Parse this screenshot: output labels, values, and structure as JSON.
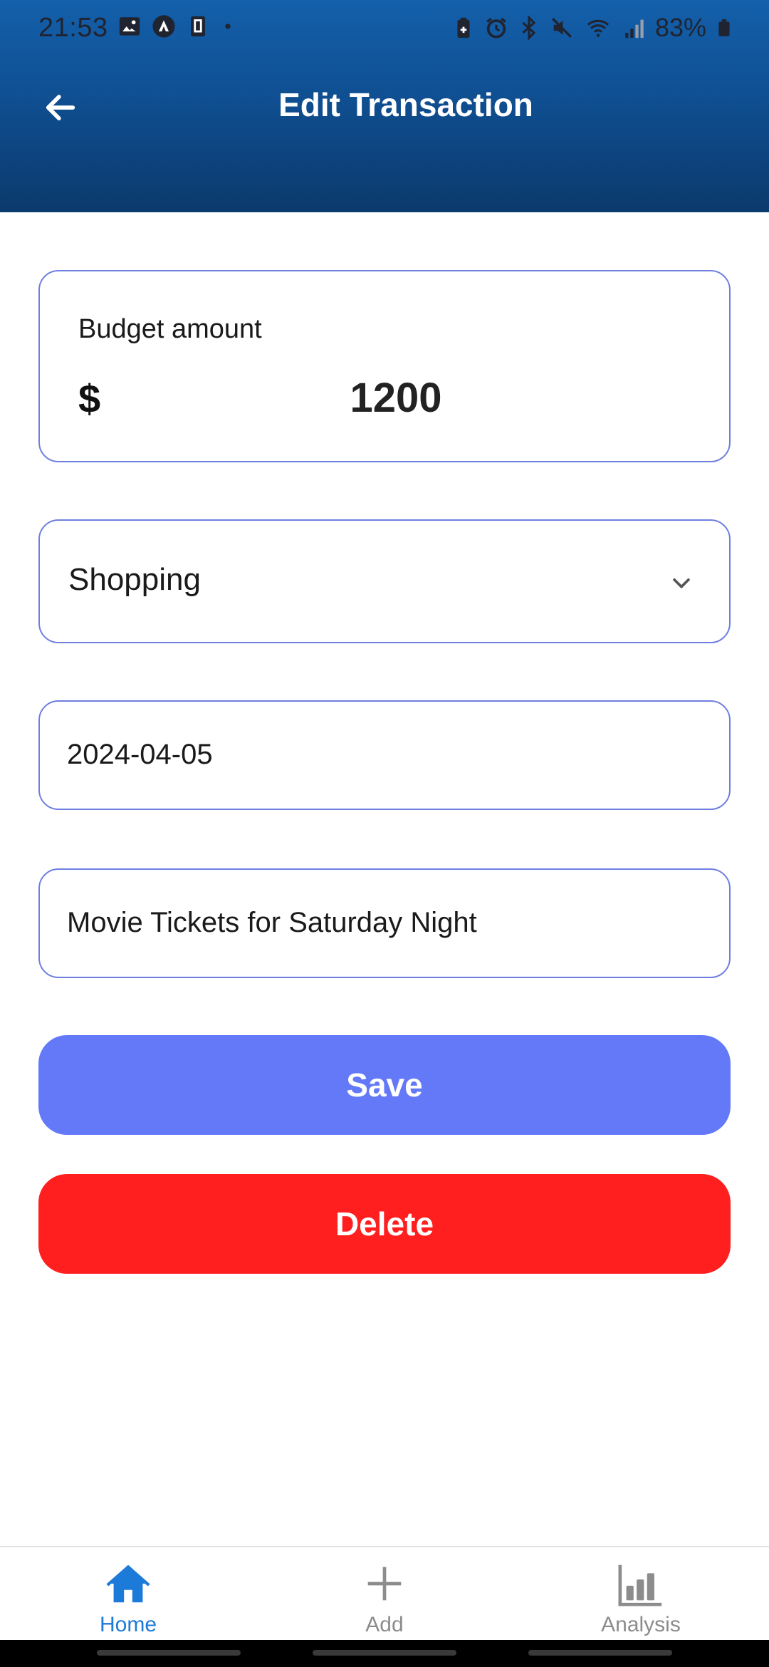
{
  "status_bar": {
    "time": "21:53",
    "battery": "83%",
    "left_icons": [
      "gallery-icon",
      "app-icon",
      "device-icon",
      "dot-icon"
    ],
    "right_icons": [
      "battery-saver-icon",
      "alarm-icon",
      "bluetooth-icon",
      "mute-icon",
      "wifi-icon",
      "signal-icon",
      "battery-icon"
    ]
  },
  "header": {
    "title": "Edit Transaction",
    "back_icon": "arrow-left-icon",
    "gradient": [
      "#1460ab",
      "#0b3a6c"
    ]
  },
  "form": {
    "amount_label": "Budget amount",
    "currency_symbol": "$",
    "amount_value": "1200",
    "category_value": "Shopping",
    "category_icon": "chevron-down-icon",
    "date_value": "2024-04-05",
    "note_value": "Movie Tickets for Saturday Night",
    "border_color": "#6e7fe0"
  },
  "actions": {
    "save_label": "Save",
    "save_color": "#6479f7",
    "delete_label": "Delete",
    "delete_color": "#ff1f1f"
  },
  "bottom_nav": {
    "items": [
      {
        "label": "Home",
        "icon": "home-icon",
        "active": true
      },
      {
        "label": "Add",
        "icon": "plus-icon",
        "active": false
      },
      {
        "label": "Analysis",
        "icon": "bar-chart-icon",
        "active": false
      }
    ],
    "active_color": "#1c7ad9"
  }
}
